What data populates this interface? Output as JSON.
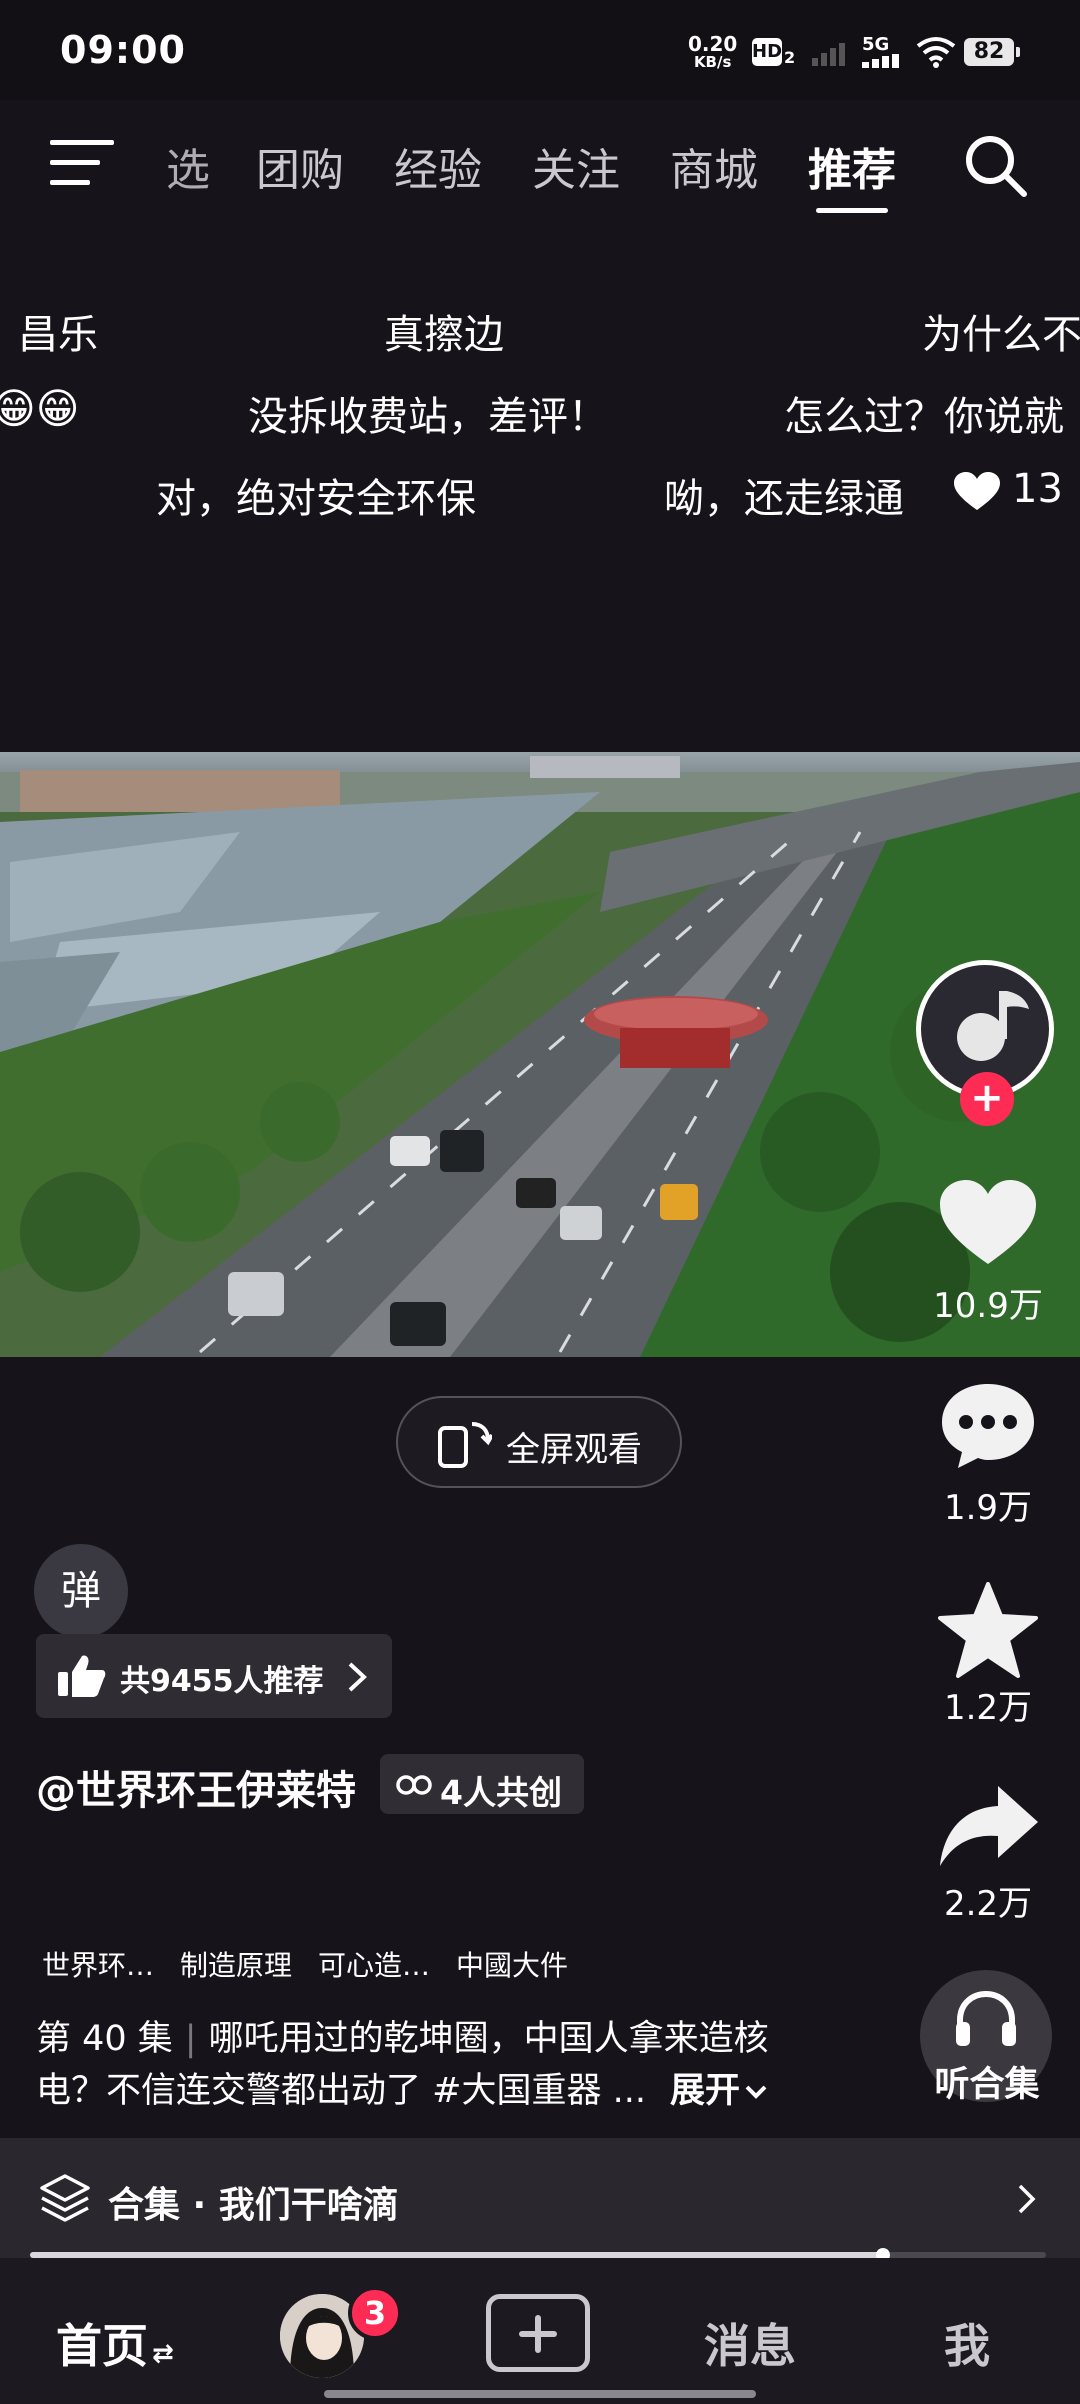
{
  "status_bar": {
    "time": "09:00",
    "net_speed_value": "0.20",
    "net_speed_unit": "KB/s",
    "hd_label": "HD",
    "hd_sub": "2",
    "network": "5G",
    "battery": "82"
  },
  "top_nav": {
    "tabs": [
      "选",
      "团购",
      "经验",
      "关注",
      "商城",
      "推荐"
    ],
    "active_tab": "推荐"
  },
  "danmaku": {
    "line1": [
      "昌乐",
      "真擦边",
      "为什么不"
    ],
    "line2_emoji": "😁😁",
    "line2": [
      "没拆收费站，差评！",
      "怎么过？你说就"
    ],
    "line3": [
      "对，绝对安全环保",
      "呦，还走绿通"
    ],
    "line3_likes": "13"
  },
  "right_rail": {
    "like_count": "10.9万",
    "comment_count": "1.9万",
    "favorite_count": "1.2万",
    "share_count": "2.2万",
    "listen_label": "听合集"
  },
  "player": {
    "fullscreen_label": "全屏观看",
    "danmu_toggle": "弹"
  },
  "info": {
    "recommend": "共9455人推荐",
    "author": "@世界环王伊莱特",
    "cocreate": "4人共创",
    "tags": [
      "世界环…",
      "制造原理",
      "可心造…",
      "中國大件"
    ],
    "episode": "第 40 集",
    "desc_line1": "哪吒用过的乾坤圈，中国人拿来造核",
    "desc_line2": "电？不信连交警都出动了 #大国重器 ...",
    "expand": "展开"
  },
  "collection": {
    "label": "合集 · 我们干啥滴",
    "progress": 0.84
  },
  "bottom_nav": {
    "home": "首页",
    "badge": "3",
    "messages": "消息",
    "me": "我"
  },
  "colors": {
    "background": "#16141a",
    "accent": "#fe2c55"
  }
}
